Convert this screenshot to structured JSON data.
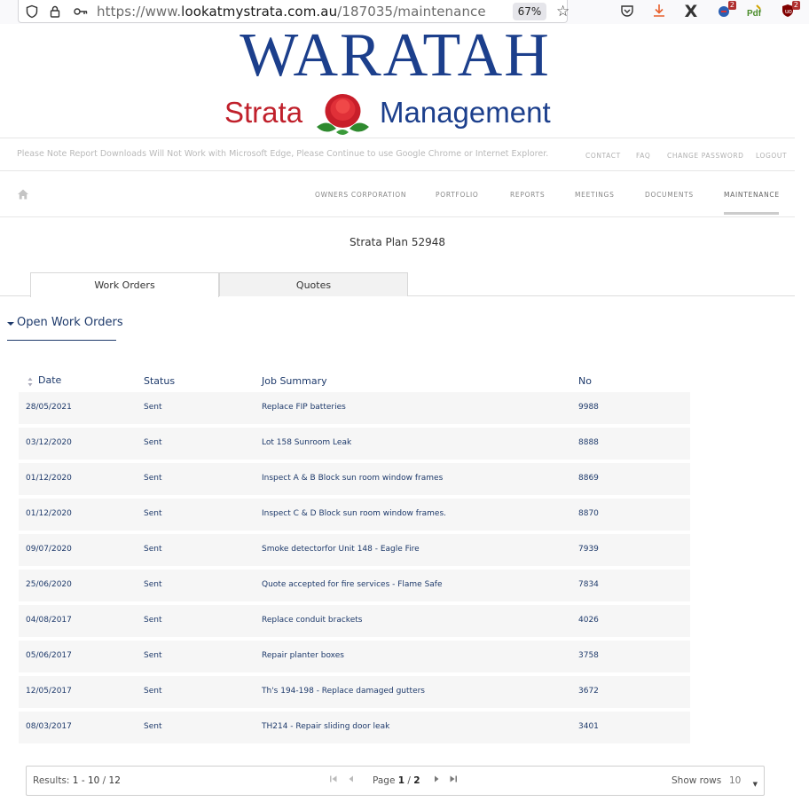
{
  "browser": {
    "url_prefix": "https://www.",
    "url_host": "lookatmystrata.com.au",
    "url_path": "/187035/maintenance",
    "zoom": "67%",
    "ext_badge_1": "2",
    "ext_badge_2": "2"
  },
  "logo": {
    "main": "WARATAH",
    "left": "Strata",
    "right": "Management"
  },
  "notice": "Please Note Report Downloads Will Not Work with Microsoft Edge, Please Continue to use Google Chrome or Internet Explorer.",
  "top_links": [
    "CONTACT",
    "FAQ",
    "CHANGE PASSWORD",
    "LOGOUT"
  ],
  "nav": [
    "OWNERS CORPORATION",
    "PORTFOLIO",
    "REPORTS",
    "MEETINGS",
    "DOCUMENTS",
    "MAINTENANCE"
  ],
  "plan_title": "Strata Plan 52948",
  "tabs": [
    "Work Orders",
    "Quotes"
  ],
  "section": "Open Work Orders",
  "table": {
    "headers": [
      "Date",
      "Status",
      "Job Summary",
      "No"
    ],
    "rows": [
      [
        "28/05/2021",
        "Sent",
        "Replace FIP batteries",
        "9988"
      ],
      [
        "03/12/2020",
        "Sent",
        "Lot 158 Sunroom Leak",
        "8888"
      ],
      [
        "01/12/2020",
        "Sent",
        "Inspect A & B Block sun room window frames",
        "8869"
      ],
      [
        "01/12/2020",
        "Sent",
        "Inspect C & D Block sun room window frames.",
        "8870"
      ],
      [
        "09/07/2020",
        "Sent",
        "Smoke detectorfor Unit 148 - Eagle Fire",
        "7939"
      ],
      [
        "25/06/2020",
        "Sent",
        "Quote accepted for fire services - Flame Safe",
        "7834"
      ],
      [
        "04/08/2017",
        "Sent",
        "Replace conduit brackets",
        "4026"
      ],
      [
        "05/06/2017",
        "Sent",
        "Repair planter boxes",
        "3758"
      ],
      [
        "12/05/2017",
        "Sent",
        "Th's 194-198 - Replace damaged gutters",
        "3672"
      ],
      [
        "08/03/2017",
        "Sent",
        "TH214 - Repair sliding door leak",
        "3401"
      ]
    ]
  },
  "pager": {
    "results_label": "Results:",
    "results_range": "1 - 10",
    "results_sep": " / ",
    "results_total": "12",
    "page_label": "Page",
    "page_current": "1",
    "page_total": "2",
    "show_rows_label": "Show rows",
    "rows_value": "10"
  }
}
